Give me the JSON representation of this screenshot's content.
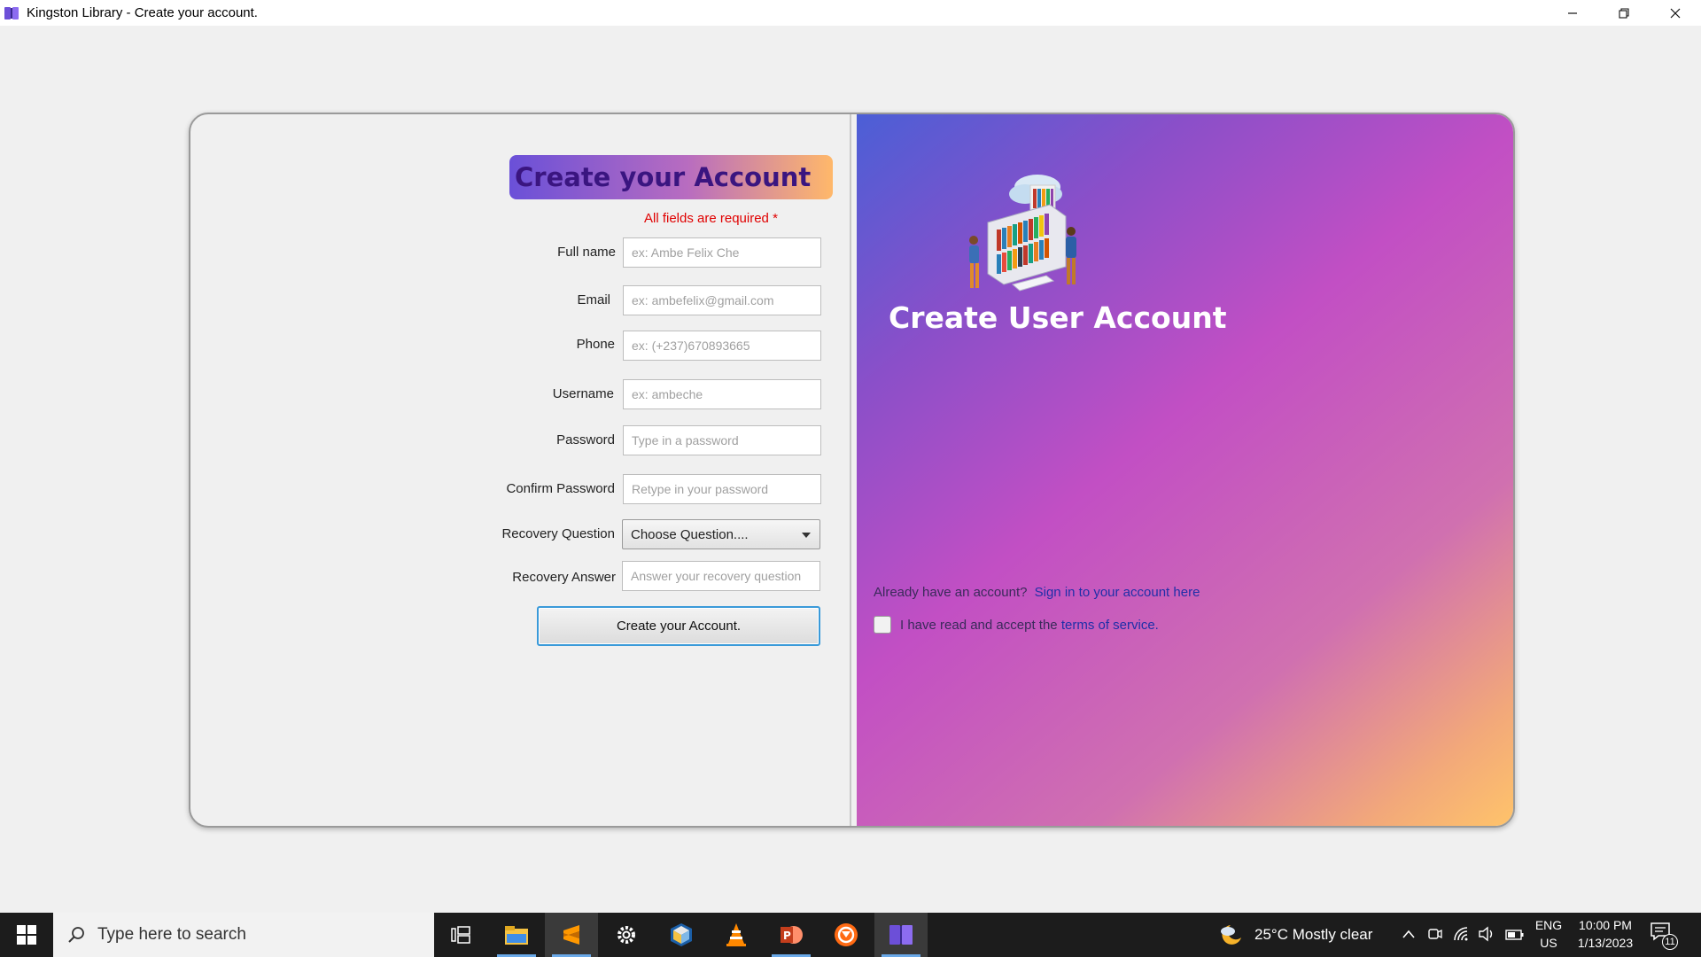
{
  "window": {
    "title": "Kingston Library -  Create your account.",
    "controls": [
      "minimize",
      "restore",
      "close"
    ]
  },
  "form": {
    "heading": "Create your Account",
    "required_note": "All fields are required *",
    "fields": [
      {
        "label": "Full name",
        "placeholder": "ex: Ambe Felix Che"
      },
      {
        "label": "Email",
        "placeholder": "ex: ambefelix@gmail.com"
      },
      {
        "label": "Phone",
        "placeholder": "ex: (+237)670893665"
      },
      {
        "label": "Username",
        "placeholder": "ex: ambeche"
      },
      {
        "label": "Password",
        "placeholder": "Type in a password"
      },
      {
        "label": "Confirm Password",
        "placeholder": "Retype in your password"
      },
      {
        "label": "Recovery Question",
        "selected": "Choose Question...."
      },
      {
        "label": "Recovery Answer",
        "placeholder": "Answer your recovery question"
      }
    ],
    "submit_label": "Create your Account."
  },
  "side_panel": {
    "heading": "Create User Account",
    "signin_prompt": "Already have an account?",
    "signin_link": "Sign in to your account here",
    "terms_prefix": "I have read and accept the",
    "terms_link": "terms of service.",
    "terms_checked": false
  },
  "taskbar": {
    "search_placeholder": "Type here to search",
    "apps": [
      "task-view-icon",
      "file-explorer-icon",
      "sublime-text-icon",
      "settings-icon",
      "virtualbox-icon",
      "vlc-icon",
      "powerpoint-icon",
      "brave-icon",
      "library-app-icon"
    ],
    "weather": "25°C  Mostly clear",
    "language": "ENG",
    "region": "US",
    "time": "10:00 PM",
    "date": "1/13/2023",
    "notifications": "11"
  },
  "colors": {
    "accent": "#3a9ad9",
    "required": "#e00000",
    "link": "#1f2fa8"
  }
}
